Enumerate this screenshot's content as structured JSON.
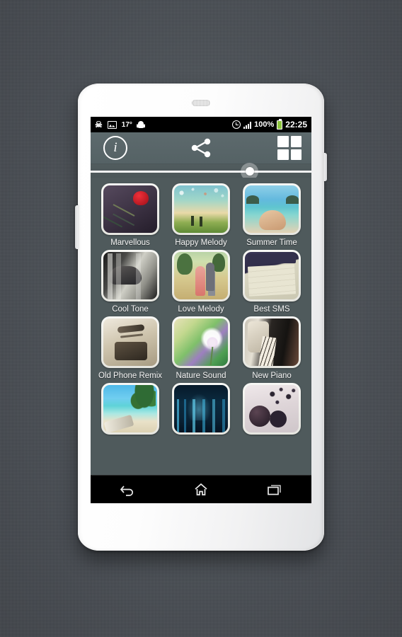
{
  "statusbar": {
    "temperature": "17°",
    "battery_percent": "100%",
    "time": "22:25",
    "icons": [
      "usb-icon",
      "gallery-icon",
      "android-icon",
      "alarm-clock-icon",
      "signal-icon",
      "battery-icon"
    ]
  },
  "actionbar": {
    "info_label": "i",
    "info_name": "info-icon",
    "share_name": "share-icon",
    "grid_name": "grid-view-icon"
  },
  "slider": {
    "value_percent": 72
  },
  "grid": {
    "rows": [
      {
        "tiles": [
          {
            "label": "Marvellous",
            "art": "art-rose"
          },
          {
            "label": "Happy Melody",
            "art": "art-sky"
          },
          {
            "label": "Summer Time",
            "art": "art-beach"
          }
        ]
      },
      {
        "tiles": [
          {
            "label": "Cool Tone",
            "art": "art-cool"
          },
          {
            "label": "Love Melody",
            "art": "art-love"
          },
          {
            "label": "Best SMS",
            "art": "art-sms"
          }
        ]
      },
      {
        "tiles": [
          {
            "label": "Old Phone Remix",
            "art": "art-phone"
          },
          {
            "label": "Nature Sound",
            "art": "art-nature"
          },
          {
            "label": "New Piano",
            "art": "art-piano"
          }
        ]
      },
      {
        "tiles": [
          {
            "label": "",
            "art": "art-island"
          },
          {
            "label": "",
            "art": "art-city"
          },
          {
            "label": "",
            "art": "art-phones"
          }
        ]
      }
    ]
  },
  "navbar": {
    "back": "back-icon",
    "home": "home-icon",
    "recents": "recent-apps-icon"
  },
  "colors": {
    "wallpaper": "#4b5057",
    "app_background": "#4f5a5c",
    "action_bar": "#5d6a6d",
    "accent": "#ffffff",
    "battery_green": "#8ec63f"
  }
}
